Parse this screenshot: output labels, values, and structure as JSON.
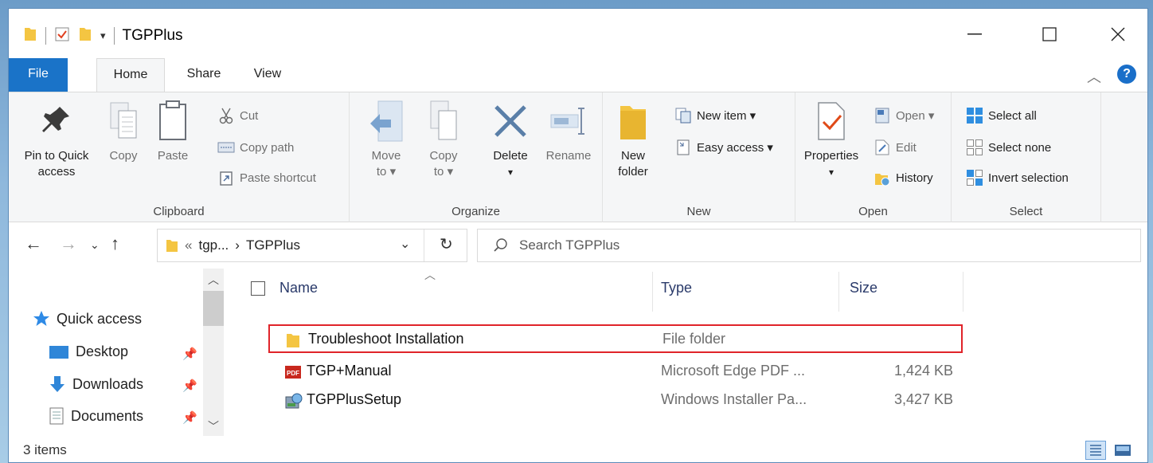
{
  "window": {
    "title": "TGPPlus"
  },
  "tabs": {
    "file": "File",
    "home": "Home",
    "share": "Share",
    "view": "View"
  },
  "ribbon": {
    "clipboard": {
      "label": "Clipboard",
      "pin_line1": "Pin to Quick",
      "pin_line2": "access",
      "copy": "Copy",
      "paste": "Paste",
      "cut": "Cut",
      "copy_path": "Copy path",
      "paste_shortcut": "Paste shortcut"
    },
    "organize": {
      "label": "Organize",
      "move_line1": "Move",
      "move_line2": "to ▾",
      "copy_line1": "Copy",
      "copy_line2": "to ▾",
      "delete": "Delete",
      "delete_caret": "▾",
      "rename": "Rename"
    },
    "new": {
      "label": "New",
      "folder_line1": "New",
      "folder_line2": "folder",
      "new_item": "New item ▾",
      "easy_access": "Easy access ▾"
    },
    "open": {
      "label": "Open",
      "properties": "Properties",
      "properties_caret": "▾",
      "open": "Open ▾",
      "edit": "Edit",
      "history": "History"
    },
    "select": {
      "label": "Select",
      "select_all": "Select all",
      "select_none": "Select none",
      "invert": "Invert selection"
    }
  },
  "address": {
    "prefix": "«",
    "crumb1": "tgp...",
    "arrow": "›",
    "crumb2": "TGPPlus"
  },
  "search": {
    "placeholder": "Search TGPPlus"
  },
  "nav_pane": {
    "items": [
      {
        "label": "Quick access"
      },
      {
        "label": "Desktop"
      },
      {
        "label": "Downloads"
      },
      {
        "label": "Documents"
      }
    ]
  },
  "columns": {
    "name": "Name",
    "type": "Type",
    "size": "Size"
  },
  "files": [
    {
      "name": "Troubleshoot Installation",
      "type": "File folder",
      "size": ""
    },
    {
      "name": "TGP+Manual",
      "type": "Microsoft Edge PDF ...",
      "size": "1,424 KB"
    },
    {
      "name": "TGPPlusSetup",
      "type": "Windows Installer Pa...",
      "size": "3,427 KB"
    }
  ],
  "status": {
    "count": "3 items"
  },
  "colors": {
    "accent": "#1a73c8",
    "highlight": "#e0242a",
    "folder": "#f4c542"
  }
}
